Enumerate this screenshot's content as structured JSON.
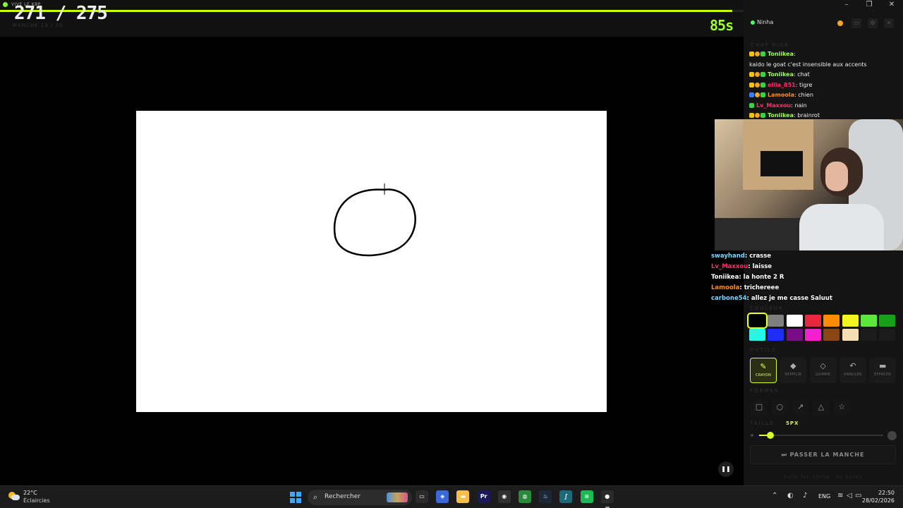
{
  "game": {
    "top_label": "VIVE LE KBP",
    "round_counter": "271 / 275",
    "round_progress": 0.985,
    "sub_label": "MANCHE 19 / 20",
    "timer": "85s"
  },
  "panel": {
    "username": "Ninha",
    "chat_title": "CHAT KICK",
    "chat": [
      {
        "badges": [
          "crown",
          "coin",
          "green"
        ],
        "name": "Toniikea",
        "name_color": "#9cff5a",
        "text": "",
        "partial": true
      },
      {
        "badges": [],
        "name": "",
        "name_color": "#eeeeee",
        "text": "kaido le goat c'est insensible aux accents"
      },
      {
        "badges": [
          "crown",
          "coin",
          "green"
        ],
        "name": "Toniikea",
        "name_color": "#9cff5a",
        "text": "chat"
      },
      {
        "badges": [
          "crown",
          "coin",
          "green"
        ],
        "name": "ellia_851",
        "name_color": "#ff2e6a",
        "text": "tigre"
      },
      {
        "badges": [
          "blue",
          "coin",
          "green"
        ],
        "name": "Lamoola",
        "name_color": "#ff8c1a",
        "text": "chien"
      },
      {
        "badges": [
          "green"
        ],
        "name": "Lv_Maxxou",
        "name_color": "#ff2e6a",
        "text": "nain"
      },
      {
        "badges": [
          "crown",
          "coin",
          "green"
        ],
        "name": "Toniikea",
        "name_color": "#9cff5a",
        "text": "brainrot"
      }
    ],
    "overlay_chat": [
      {
        "name": "swayhand",
        "name_color": "#7ad7ff",
        "text": "crasse"
      },
      {
        "name": "Lv_Maxxou",
        "name_color": "#ff2e6a",
        "text": "laisse"
      },
      {
        "name": "Toniikea",
        "name_color": "#ffffff",
        "text": "la honte 2 R"
      },
      {
        "name": "Lamoola",
        "name_color": "#ff8c1a",
        "text": "trichereee"
      },
      {
        "name": "carbone54",
        "name_color": "#7ad7ff",
        "text": "allez je me casse Saluut"
      }
    ],
    "colors_title": "COULEUR",
    "colors": [
      "#000000",
      "#7f7f7f",
      "#ffffff",
      "#e8263c",
      "#ff8c00",
      "#f5f51e",
      "#5be83a",
      "#18a018",
      "#27f5e6",
      "#1e2ef5",
      "#7a0c8a",
      "#f51ed0",
      "#8b4513",
      "#f5deb3"
    ],
    "selected_color": "#000000",
    "tools_title": "OUTILS",
    "tools": [
      {
        "label": "CRAYON",
        "icon": "pencil-icon",
        "glyph": "✎"
      },
      {
        "label": "REMPLIR",
        "icon": "fill-icon",
        "glyph": "◆"
      },
      {
        "label": "GOMME",
        "icon": "eraser-icon",
        "glyph": "◇"
      },
      {
        "label": "ANNULER",
        "icon": "undo-icon",
        "glyph": "↶"
      },
      {
        "label": "EFFACER",
        "icon": "trash-icon",
        "glyph": "▬"
      }
    ],
    "active_tool": "CRAYON",
    "shapes_title": "FORMES",
    "shapes": [
      {
        "icon": "rectangle-icon",
        "glyph": "□"
      },
      {
        "icon": "ellipse-icon",
        "glyph": "○"
      },
      {
        "icon": "arrow-icon",
        "glyph": "↗"
      },
      {
        "icon": "triangle-icon",
        "glyph": "△"
      },
      {
        "icon": "star-icon",
        "glyph": "☆"
      }
    ],
    "size_title": "TAILLE",
    "size_value": "5PX",
    "size_fraction": 0.09,
    "skip_label": "⏭ PASSER LA MANCHE",
    "footer": "built for ninha · by kaido",
    "accent": "#d8ff2e"
  },
  "taskbar": {
    "weather_temp": "22°C",
    "weather_desc": "Éclaircies",
    "search_placeholder": "Rechercher",
    "apps": [
      {
        "name": "file-explorer-icon",
        "glyph": "▭",
        "color": "#2b2b2b"
      },
      {
        "name": "store-icon",
        "glyph": "◈",
        "color": "#3a6ad9"
      },
      {
        "name": "folder-icon",
        "glyph": "▬",
        "color": "#f5c04a"
      },
      {
        "name": "premiere-icon",
        "glyph": "Pr",
        "color": "#1a1a5a"
      },
      {
        "name": "obs-icon",
        "glyph": "◉",
        "color": "#303030"
      },
      {
        "name": "chrome-icon",
        "glyph": "◍",
        "color": "#2a8a3a"
      },
      {
        "name": "steam-icon",
        "glyph": "♨",
        "color": "#1b2838"
      },
      {
        "name": "app-icon",
        "glyph": "∫",
        "color": "#1a6a7a"
      },
      {
        "name": "spotify-icon",
        "glyph": "≋",
        "color": "#1db954"
      },
      {
        "name": "kick-icon",
        "glyph": "●",
        "color": "#2a2a2a"
      }
    ],
    "lang": "ENG",
    "time": "22:50",
    "date": "28/02/2026"
  }
}
